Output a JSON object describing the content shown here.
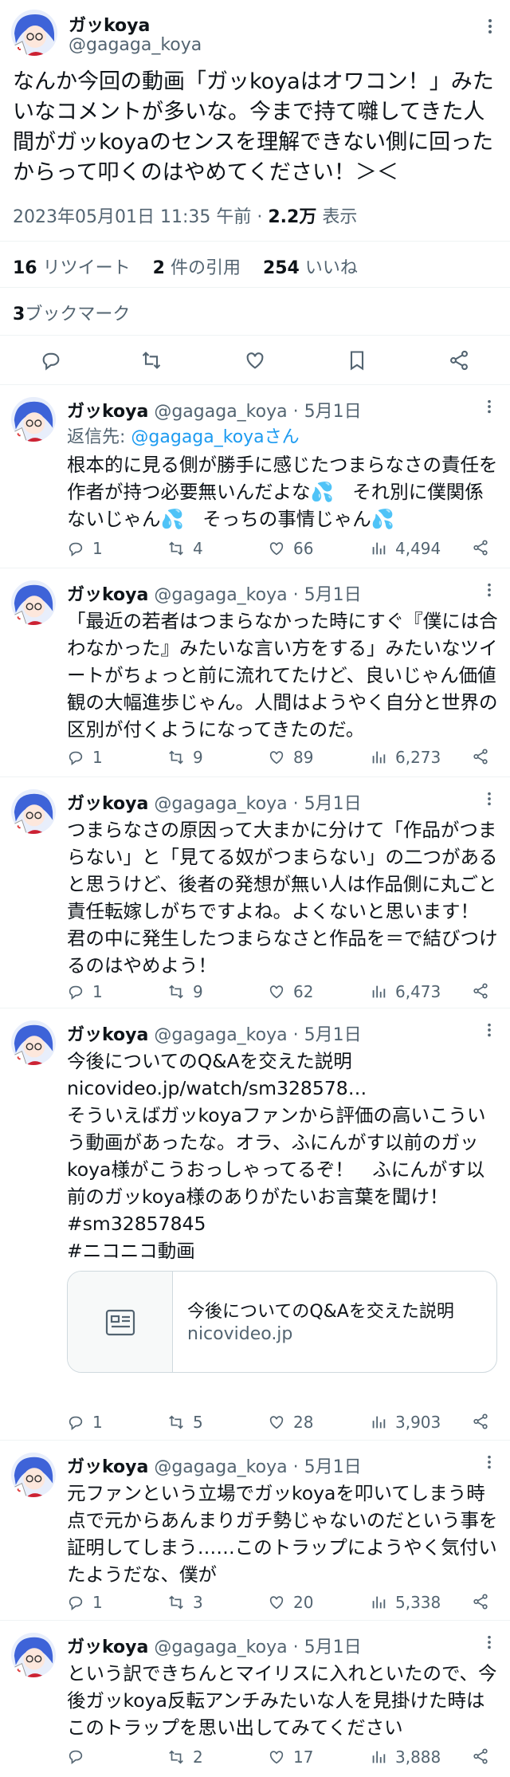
{
  "main": {
    "name": "ガッkoya",
    "handle": "@gagaga_koya",
    "text": "なんか今回の動画「ガッkoyaはオワコン！」みたいなコメントが多いな。今まで持て囃してきた人間がガッkoyaのセンスを理解できない側に回ったからって叩くのはやめてください！＞＜",
    "time": "2023年05月01日 11:35 午前",
    "views_count": "2.2万",
    "views_label": "表示",
    "retweets_count": "16",
    "retweets_label": "リツイート",
    "quotes_count": "2",
    "quotes_label": "件の引用",
    "likes_count": "254",
    "likes_label": "いいね",
    "bookmarks_count": "3",
    "bookmarks_label": "ブックマーク"
  },
  "replies": [
    {
      "name": "ガッkoya",
      "handle": "@gagaga_koya",
      "date": "5月1日",
      "reply_to_label": "返信先: ",
      "reply_to_handle": "@gagaga_koyaさん",
      "text": "根本的に見る側が勝手に感じたつまらなさの責任を作者が持つ必要無いんだよな💦　それ別に僕関係ないじゃん💦　そっちの事情じゃん💦",
      "replies": "1",
      "retweets": "4",
      "likes": "66",
      "views": "4,494"
    },
    {
      "name": "ガッkoya",
      "handle": "@gagaga_koya",
      "date": "5月1日",
      "text": "「最近の若者はつまらなかった時にすぐ『僕には合わなかった』みたいな言い方をする」みたいなツイートがちょっと前に流れてたけど、良いじゃん価値観の大幅進歩じゃん。人間はようやく自分と世界の区別が付くようになってきたのだ。",
      "replies": "1",
      "retweets": "9",
      "likes": "89",
      "views": "6,273"
    },
    {
      "name": "ガッkoya",
      "handle": "@gagaga_koya",
      "date": "5月1日",
      "text": "つまらなさの原因って大まかに分けて「作品がつまらない」と「見てる奴がつまらない」の二つがあると思うけど、後者の発想が無い人は作品側に丸ごと責任転嫁しがちですよね。よくないと思います！　君の中に発生したつまらなさと作品を＝で結びつけるのはやめよう！",
      "replies": "1",
      "retweets": "9",
      "likes": "62",
      "views": "6,473"
    },
    {
      "name": "ガッkoya",
      "handle": "@gagaga_koya",
      "date": "5月1日",
      "text_line1": "今後についてのQ&Aを交えた説明",
      "link": "nicovideo.jp/watch/sm328578…",
      "text": "そういえばガッkoyaファンから評価の高いこういう動画があったな。オラ、ふにんがす以前のガッkoya様がこうおっしゃってるぞ！　ふにんがす以前のガッkoya様のありがたいお言葉を聞け！",
      "hashtag1": "#sm32857845",
      "hashtag2": "#ニコニコ動画",
      "card_title": "今後についてのQ&Aを交えた説明",
      "card_domain": "nicovideo.jp",
      "replies": "1",
      "retweets": "5",
      "likes": "28",
      "views": "3,903"
    },
    {
      "name": "ガッkoya",
      "handle": "@gagaga_koya",
      "date": "5月1日",
      "text": "元ファンという立場でガッkoyaを叩いてしまう時点で元からあんまりガチ勢じゃないのだという事を証明してしまう……このトラップにようやく気付いたようだな、僕が",
      "replies": "1",
      "retweets": "3",
      "likes": "20",
      "views": "5,338"
    },
    {
      "name": "ガッkoya",
      "handle": "@gagaga_koya",
      "date": "5月1日",
      "text": "という訳できちんとマイリスに入れといたので、今後ガッkoya反転アンチみたいな人を見掛けた時はこのトラップを思い出してみてください",
      "replies": "",
      "retweets": "2",
      "likes": "17",
      "views": "3,888"
    }
  ],
  "colors": {
    "accent": "#1d9bf0",
    "text": "#0f1419",
    "secondary": "#536471",
    "border": "#eff3f4"
  }
}
